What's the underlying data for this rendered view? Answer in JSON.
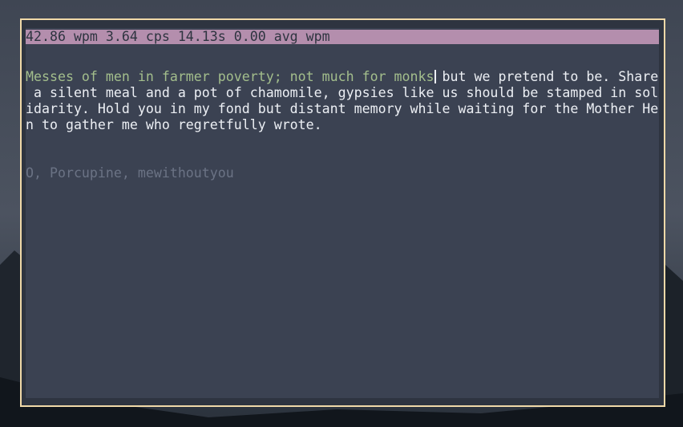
{
  "stats": {
    "text": "42.86 wpm 3.64 cps 14.13s 0.00 avg wpm"
  },
  "quote": {
    "typed": "Messes of men in farmer poverty; not much for monks",
    "line1_rest": " but we pretend to be. Share",
    "line2": " a silent meal and a pot of chamomile, gypsies like us should be stamped in sol",
    "line3": "idarity. Hold you in my fond but distant memory while waiting for the Mother He",
    "line4": "n to gather me who regretfully wrote."
  },
  "attribution": {
    "text": "O, Porcupine, mewithoutyou"
  },
  "colors": {
    "stats_bar": "#b48ead",
    "typed_text": "#a3be8c",
    "pending_text": "#eceff4",
    "attribution_text": "#6b7385",
    "window_border": "#f0d9a8",
    "terminal_bg": "#3b4252"
  }
}
